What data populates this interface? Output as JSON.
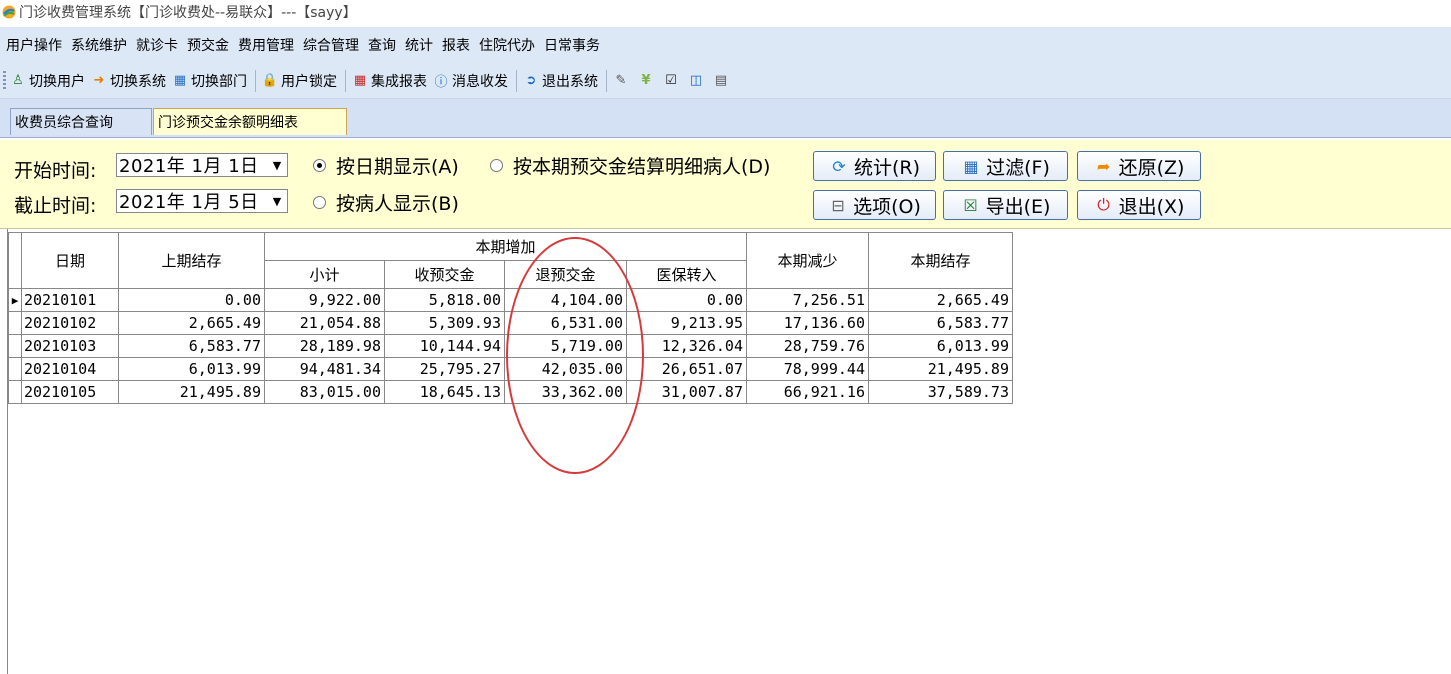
{
  "window": {
    "title": "门诊收费管理系统【门诊收费处--易联众】---【sayy】"
  },
  "menu": {
    "items": [
      "用户操作",
      "系统维护",
      "就诊卡",
      "预交金",
      "费用管理",
      "综合管理",
      "查询",
      "统计",
      "报表",
      "住院代办",
      "日常事务"
    ]
  },
  "toolbar": {
    "switch_user": "切换用户",
    "switch_system": "切换系统",
    "switch_dept": "切换部门",
    "user_lock": "用户锁定",
    "integrated_report": "集成报表",
    "message": "消息收发",
    "exit_system": "退出系统"
  },
  "tabs": {
    "inactive": "收费员综合查询",
    "active": "门诊预交金余额明细表"
  },
  "filters": {
    "start_label": "开始时间:",
    "start_value": "2021年 1月 1日",
    "end_label": "截止时间:",
    "end_value": "2021年 1月 5日",
    "radio_by_date": "按日期显示(A)",
    "radio_by_settle": "按本期预交金结算明细病人(D)",
    "radio_by_patient": "按病人显示(B)",
    "selected": "by_date"
  },
  "buttons": {
    "stats": "统计(R)",
    "filter": "过滤(F)",
    "restore": "还原(Z)",
    "options": "选项(O)",
    "export": "导出(E)",
    "exit": "退出(X)"
  },
  "table": {
    "headers": {
      "date": "日期",
      "prev_balance": "上期结存",
      "increase_group": "本期增加",
      "subtotal": "小计",
      "received": "收预交金",
      "refunded": "退预交金",
      "insurance": "医保转入",
      "decrease": "本期减少",
      "balance": "本期结存"
    },
    "rows": [
      {
        "date": "20210101",
        "prev": "0.00",
        "subtotal": "9,922.00",
        "received": "5,818.00",
        "refunded": "4,104.00",
        "insurance": "0.00",
        "decrease": "7,256.51",
        "balance": "2,665.49",
        "current": true
      },
      {
        "date": "20210102",
        "prev": "2,665.49",
        "subtotal": "21,054.88",
        "received": "5,309.93",
        "refunded": "6,531.00",
        "insurance": "9,213.95",
        "decrease": "17,136.60",
        "balance": "6,583.77"
      },
      {
        "date": "20210103",
        "prev": "6,583.77",
        "subtotal": "28,189.98",
        "received": "10,144.94",
        "refunded": "5,719.00",
        "insurance": "12,326.04",
        "decrease": "28,759.76",
        "balance": "6,013.99"
      },
      {
        "date": "20210104",
        "prev": "6,013.99",
        "subtotal": "94,481.34",
        "received": "25,795.27",
        "refunded": "42,035.00",
        "insurance": "26,651.07",
        "decrease": "78,999.44",
        "balance": "21,495.89"
      },
      {
        "date": "20210105",
        "prev": "21,495.89",
        "subtotal": "83,015.00",
        "received": "18,645.13",
        "refunded": "33,362.00",
        "insurance": "31,007.87",
        "decrease": "66,921.16",
        "balance": "37,589.73"
      }
    ]
  },
  "colors": {
    "panel_bg": "#ffffd2",
    "menubar_bg": "#dde8f7",
    "annotation_circle": "#d63a3a"
  }
}
